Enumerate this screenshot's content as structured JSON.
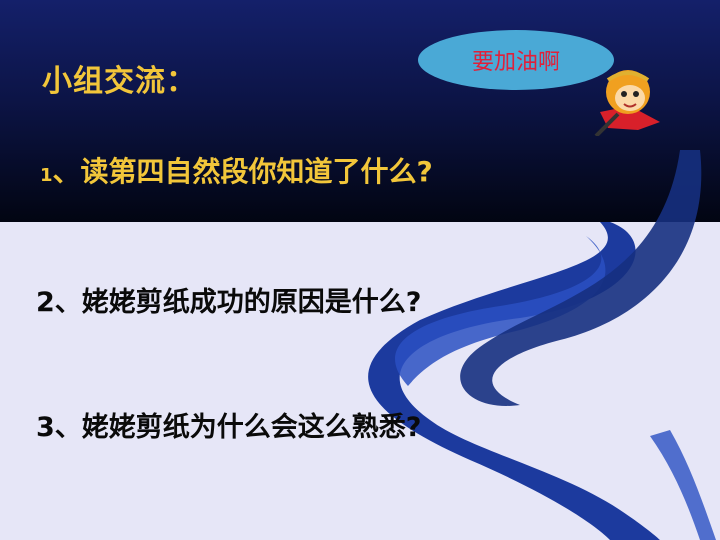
{
  "slide": {
    "title": "小组交流：",
    "badge": "要加油啊",
    "questions": [
      {
        "num": "1",
        "text": "、读第四自然段你知道了什么?"
      },
      {
        "num": "2",
        "text": "、姥姥剪纸成功的原因是什么?"
      },
      {
        "num": "3",
        "text": "、姥姥剪纸为什么会这么熟悉?"
      }
    ]
  },
  "colors": {
    "header_gradient_top": "#14206a",
    "header_gradient_bottom": "#020512",
    "background": "#e6e6f7",
    "title": "#f2c63a",
    "badge_fill": "#4aa9d6",
    "badge_text": "#e0203a",
    "swoosh": "#1c3a9e"
  },
  "icons": {
    "mascot": "monkey-king-mascot-icon"
  }
}
